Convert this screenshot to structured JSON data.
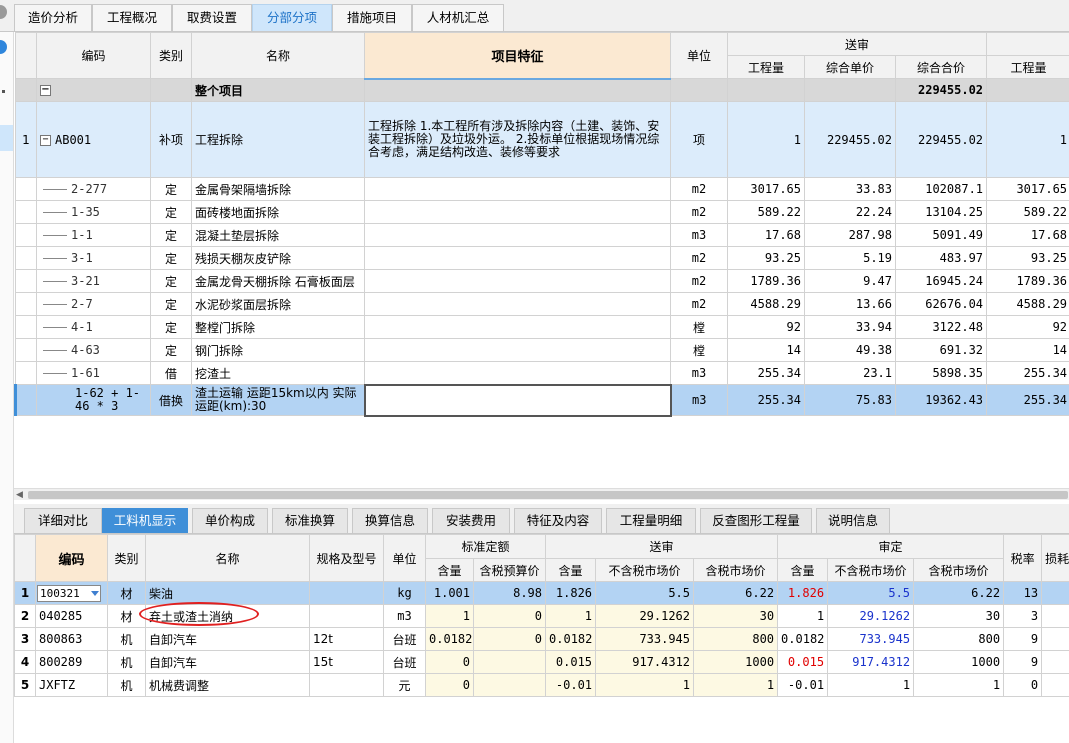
{
  "top_tabs": [
    "造价分析",
    "工程概况",
    "取费设置",
    "分部分项",
    "措施项目",
    "人材机汇总"
  ],
  "upper": {
    "headers": {
      "code": "编码",
      "type": "类别",
      "name": "名称",
      "feature": "项目特征",
      "unit": "单位",
      "group_submit": "送审",
      "qty": "工程量",
      "unit_price": "综合单价",
      "total": "综合合价",
      "qty2": "工程量"
    },
    "whole": {
      "label": "整个项目",
      "total": "229455.02"
    },
    "group": {
      "row": "1",
      "code": "AB001",
      "type": "补项",
      "name": "工程拆除",
      "desc": "工程拆除\n1.本工程所有涉及拆除内容（土建、装饰、安装工程拆除）及垃圾外运。\n2.投标单位根据现场情况综合考虑，满足结构改造、装修等要求",
      "unit": "项",
      "qty": "1",
      "unit_price": "229455.02",
      "total": "229455.02",
      "qty2": "1"
    },
    "rows": [
      {
        "code": "2-277",
        "type": "定",
        "name": "金属骨架隔墙拆除",
        "unit": "m2",
        "qty": "3017.65",
        "price": "33.83",
        "total": "102087.1",
        "qty2": "3017.65"
      },
      {
        "code": "1-35",
        "type": "定",
        "name": "面砖楼地面拆除",
        "unit": "m2",
        "qty": "589.22",
        "price": "22.24",
        "total": "13104.25",
        "qty2": "589.22"
      },
      {
        "code": "1-1",
        "type": "定",
        "name": "混凝土垫层拆除",
        "unit": "m3",
        "qty": "17.68",
        "price": "287.98",
        "total": "5091.49",
        "qty2": "17.68"
      },
      {
        "code": "3-1",
        "type": "定",
        "name": "残损天棚灰皮铲除",
        "unit": "m2",
        "qty": "93.25",
        "price": "5.19",
        "total": "483.97",
        "qty2": "93.25"
      },
      {
        "code": "3-21",
        "type": "定",
        "name": "金属龙骨天棚拆除 石膏板面层",
        "unit": "m2",
        "qty": "1789.36",
        "price": "9.47",
        "total": "16945.24",
        "qty2": "1789.36"
      },
      {
        "code": "2-7",
        "type": "定",
        "name": "水泥砂浆面层拆除",
        "unit": "m2",
        "qty": "4588.29",
        "price": "13.66",
        "total": "62676.04",
        "qty2": "4588.29"
      },
      {
        "code": "4-1",
        "type": "定",
        "name": "整樘门拆除",
        "unit": "樘",
        "qty": "92",
        "price": "33.94",
        "total": "3122.48",
        "qty2": "92"
      },
      {
        "code": "4-63",
        "type": "定",
        "name": "钢门拆除",
        "unit": "樘",
        "qty": "14",
        "price": "49.38",
        "total": "691.32",
        "qty2": "14"
      },
      {
        "code": "1-61",
        "type": "借",
        "name": "挖渣土",
        "unit": "m3",
        "qty": "255.34",
        "price": "23.1",
        "total": "5898.35",
        "qty2": "255.34"
      }
    ],
    "selected": {
      "code": "1-62 + 1-46\n* 3",
      "type": "借换",
      "name": "渣土运输 运距15km以内  实际运距(km):30",
      "unit": "m3",
      "qty": "255.34",
      "price": "75.83",
      "total": "19362.43",
      "qty2": "255.34"
    }
  },
  "bottom_tabs": [
    "详细对比",
    "工料机显示",
    "单价构成",
    "标准换算",
    "换算信息",
    "安装费用",
    "特征及内容",
    "工程量明细",
    "反查图形工程量",
    "说明信息"
  ],
  "lower": {
    "headers": {
      "code": "编码",
      "type": "类别",
      "name": "名称",
      "spec": "规格及型号",
      "unit": "单位",
      "std": "标准定额",
      "submit": "送审",
      "review": "审定",
      "tax": "税率",
      "loss": "损耗",
      "qty": "含量",
      "budget": "含税预算价",
      "notax": "不含税市场价",
      "withtax": "含税市场价"
    },
    "rows": [
      {
        "no": "1",
        "code": "100321",
        "type": "材",
        "name": "柴油",
        "spec": "",
        "unit": "kg",
        "std_qty": "1.001",
        "std_price": "8.98",
        "s_qty": "1.826",
        "s_notax": "5.5",
        "s_tax": "6.22",
        "r_qty": "1.826",
        "r_notax": "5.5",
        "r_tax": "6.22",
        "tax": "13"
      },
      {
        "no": "2",
        "code": "040285",
        "type": "材",
        "name": "弃土或渣土消纳",
        "spec": "",
        "unit": "m3",
        "std_qty": "1",
        "std_price": "0",
        "s_qty": "1",
        "s_notax": "29.1262",
        "s_tax": "30",
        "r_qty": "1",
        "r_notax": "29.1262",
        "r_tax": "30",
        "tax": "3"
      },
      {
        "no": "3",
        "code": "800863",
        "type": "机",
        "name": "自卸汽车",
        "spec": "12t",
        "unit": "台班",
        "std_qty": "0.0182",
        "std_price": "0",
        "s_qty": "0.0182",
        "s_notax": "733.945",
        "s_tax": "800",
        "r_qty": "0.0182",
        "r_notax": "733.945",
        "r_tax": "800",
        "tax": "9"
      },
      {
        "no": "4",
        "code": "800289",
        "type": "机",
        "name": "自卸汽车",
        "spec": "15t",
        "unit": "台班",
        "std_qty": "0",
        "std_price": "",
        "s_qty": "0.015",
        "s_notax": "917.4312",
        "s_tax": "1000",
        "r_qty": "0.015",
        "r_notax": "917.4312",
        "r_tax": "1000",
        "tax": "9"
      },
      {
        "no": "5",
        "code": "JXFTZ",
        "type": "机",
        "name": "机械费调整",
        "spec": "",
        "unit": "元",
        "std_qty": "0",
        "std_price": "",
        "s_qty": "-0.01",
        "s_notax": "1",
        "s_tax": "1",
        "r_qty": "-0.01",
        "r_notax": "1",
        "r_tax": "1",
        "tax": "0"
      }
    ]
  }
}
